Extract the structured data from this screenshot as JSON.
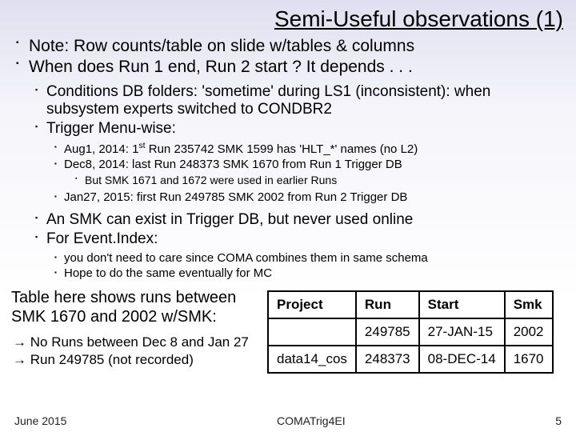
{
  "title": "Semi-Useful observations (1)",
  "bullets1": {
    "a": "Note: Row counts/table on slide w/tables & columns",
    "b": "When does Run 1 end, Run 2 start ? It depends . . ."
  },
  "bullets2": {
    "a": "Conditions DB folders: 'sometime' during LS1 (inconsistent): when subsystem experts switched to CONDBR2",
    "b": "Trigger Menu-wise:",
    "c": "An SMK can exist in Trigger DB, but never used online",
    "d": "For Event.Index:"
  },
  "bullets3": {
    "a_pre": "Aug1, 2014: 1",
    "a_sup": "st",
    "a_post": " Run 235742 SMK 1599 has 'HLT_*' names (no L2)",
    "b": "Dec8, 2014: last Run 248373 SMK 1670 from Run 1 Trigger DB",
    "c": "Jan27, 2015: first Run 249785 SMK 2002 from Run 2 Trigger DB",
    "d": "you don't need to care since COMA combines them in same schema",
    "e": "Hope to do the same eventually for MC"
  },
  "bullets4": {
    "a": "But SMK 1671 and 1672 were used in earlier Runs"
  },
  "tabletxt": "Table here shows runs between SMK 1670 and 2002 w/SMK:",
  "arrows": {
    "a": "No Runs between Dec 8 and Jan 27",
    "b": "Run 249785 (not recorded)"
  },
  "table": {
    "headers": {
      "project": "Project",
      "run": "Run",
      "start": "Start",
      "smk": "Smk"
    },
    "rows": [
      {
        "project": "",
        "run": "249785",
        "start": "27-JAN-15",
        "smk": "2002"
      },
      {
        "project": "data14_cos",
        "run": "248373",
        "start": "08-DEC-14",
        "smk": "1670"
      }
    ]
  },
  "footer": {
    "left": "June 2015",
    "center": "COMATrig4EI",
    "right": "5"
  }
}
